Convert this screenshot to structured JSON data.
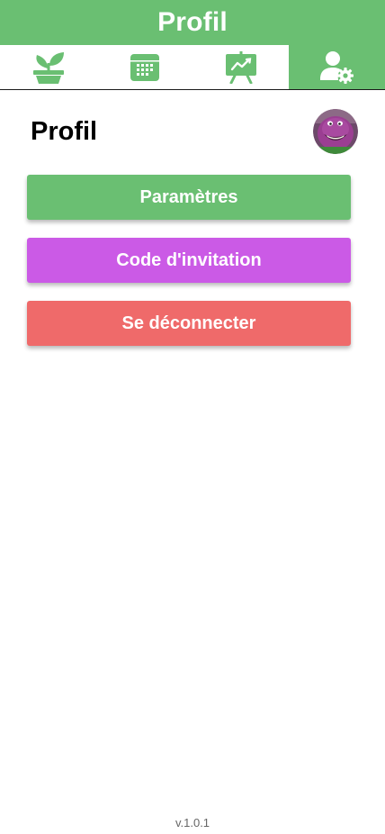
{
  "header": {
    "title": "Profil"
  },
  "tabs": [
    {
      "name": "plant-tab",
      "icon": "potted-plant-icon",
      "active": false
    },
    {
      "name": "calendar-tab",
      "icon": "calendar-icon",
      "active": false
    },
    {
      "name": "stats-tab",
      "icon": "presentation-chart-icon",
      "active": false
    },
    {
      "name": "profile-tab",
      "icon": "user-settings-icon",
      "active": true
    }
  ],
  "profile": {
    "title": "Profil",
    "avatar": "avatar-photo"
  },
  "actions": {
    "settings_label": "Paramètres",
    "invite_label": "Code d'invitation",
    "logout_label": "Se déconnecter"
  },
  "footer": {
    "version": "v.1.0.1"
  },
  "colors": {
    "primary": "#6abf72",
    "invite": "#cb5ae6",
    "logout": "#ef6a6a"
  }
}
